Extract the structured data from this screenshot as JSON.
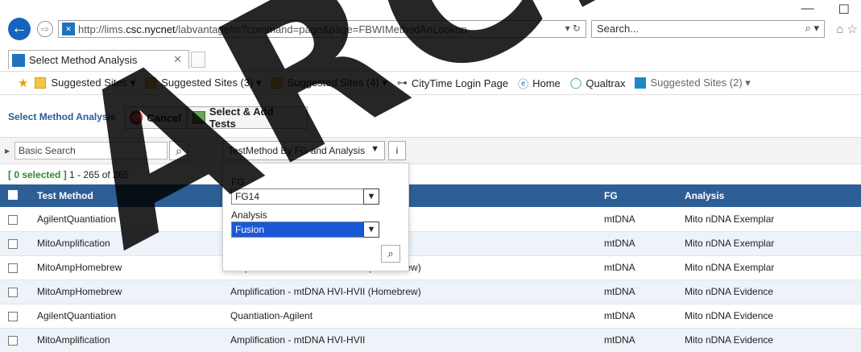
{
  "window": {
    "minimize": "—",
    "maximize": "☐"
  },
  "browser": {
    "url_prefix": "http://lims.",
    "url_host": "csc.nycnet",
    "url_path": "/labvantage/rc?command=page&page=FBWIMethodAnLookup",
    "search_placeholder": "Search...",
    "tab_title": "Select Method Analysis"
  },
  "favorites": [
    {
      "label": "Suggested Sites ▾"
    },
    {
      "label": "Suggested Sites (3) ▾"
    },
    {
      "label": "Suggested Sites (4) ▾"
    },
    {
      "label": "CityTime Login Page"
    },
    {
      "label": "Home"
    },
    {
      "label": "Qualtrax"
    },
    {
      "label": "Suggested Sites (2) ▾"
    }
  ],
  "app": {
    "title": "Select Method Analysis",
    "cancel_label": "Cancel",
    "select_add_label": "Select & Add Tests"
  },
  "search": {
    "basic_placeholder": "Basic Search",
    "lookup_label": "TestMethod By FG and Analysis",
    "info_label": "i"
  },
  "selection": {
    "selected": "[ 0 selected ]",
    "range": "1 - 265 of 265"
  },
  "popup": {
    "fg_label": "FG",
    "fg_value": "FG14",
    "analysis_label": "Analysis",
    "analysis_value": "Fusion"
  },
  "table": {
    "headers": [
      "Test Method",
      "",
      "FG",
      "Analysis"
    ],
    "rows": [
      [
        "AgilentQuantiation",
        "",
        "mtDNA",
        "Mito nDNA Exemplar"
      ],
      [
        "MitoAmplification",
        "",
        "mtDNA",
        "Mito nDNA Exemplar"
      ],
      [
        "MitoAmpHomebrew",
        "Amplification - mtDNA HVI-HVII (Homebrew)",
        "mtDNA",
        "Mito nDNA Exemplar"
      ],
      [
        "MitoAmpHomebrew",
        "Amplification - mtDNA HVI-HVII (Homebrew)",
        "mtDNA",
        "Mito nDNA Evidence"
      ],
      [
        "AgilentQuantiation",
        "Quantiation-Agilent",
        "mtDNA",
        "Mito nDNA Evidence"
      ],
      [
        "MitoAmplification",
        "Amplification - mtDNA HVI-HVII",
        "mtDNA",
        "Mito nDNA Evidence"
      ]
    ]
  },
  "watermark": "ARCH",
  "colors": {
    "header_bg": "#2d5f96",
    "selected_green": "#2e8b2e",
    "accent": "#1a58d6"
  }
}
